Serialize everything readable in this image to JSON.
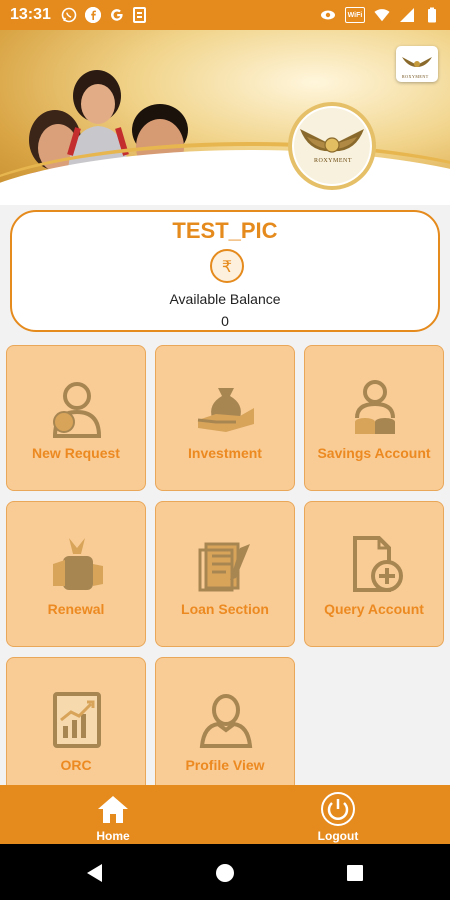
{
  "status_bar": {
    "time": "13:31",
    "left_icons": [
      "whatsapp-icon",
      "facebook-icon",
      "google-icon",
      "clipboard-icon"
    ],
    "right_icons": [
      "vpn-key-icon",
      "wifi-calling-icon",
      "wifi-icon",
      "signal-icon",
      "battery-icon"
    ],
    "wifi_label": "WiFi"
  },
  "banner": {
    "brand_small": "ROXYMENT",
    "brand_large": "ROXYMENT"
  },
  "account": {
    "name": "TEST_PIC",
    "currency_symbol": "₹",
    "balance_label": "Available Balance",
    "balance": "0"
  },
  "menu": {
    "tiles": [
      {
        "label": "New Request",
        "icon": "new-request-icon"
      },
      {
        "label": "Investment",
        "icon": "investment-icon"
      },
      {
        "label": "Savings Account",
        "icon": "savings-account-icon"
      },
      {
        "label": "Renewal",
        "icon": "renewal-icon"
      },
      {
        "label": "Loan Section",
        "icon": "loan-section-icon"
      },
      {
        "label": "Query Account",
        "icon": "query-account-icon"
      },
      {
        "label": "ORC",
        "icon": "orc-icon"
      },
      {
        "label": "Profile View",
        "icon": "profile-view-icon"
      }
    ]
  },
  "bottom_nav": {
    "home": "Home",
    "logout": "Logout"
  },
  "colors": {
    "accent": "#e58a1c",
    "tile_bg": "#f9cc96",
    "tile_text": "#ec8a21"
  }
}
